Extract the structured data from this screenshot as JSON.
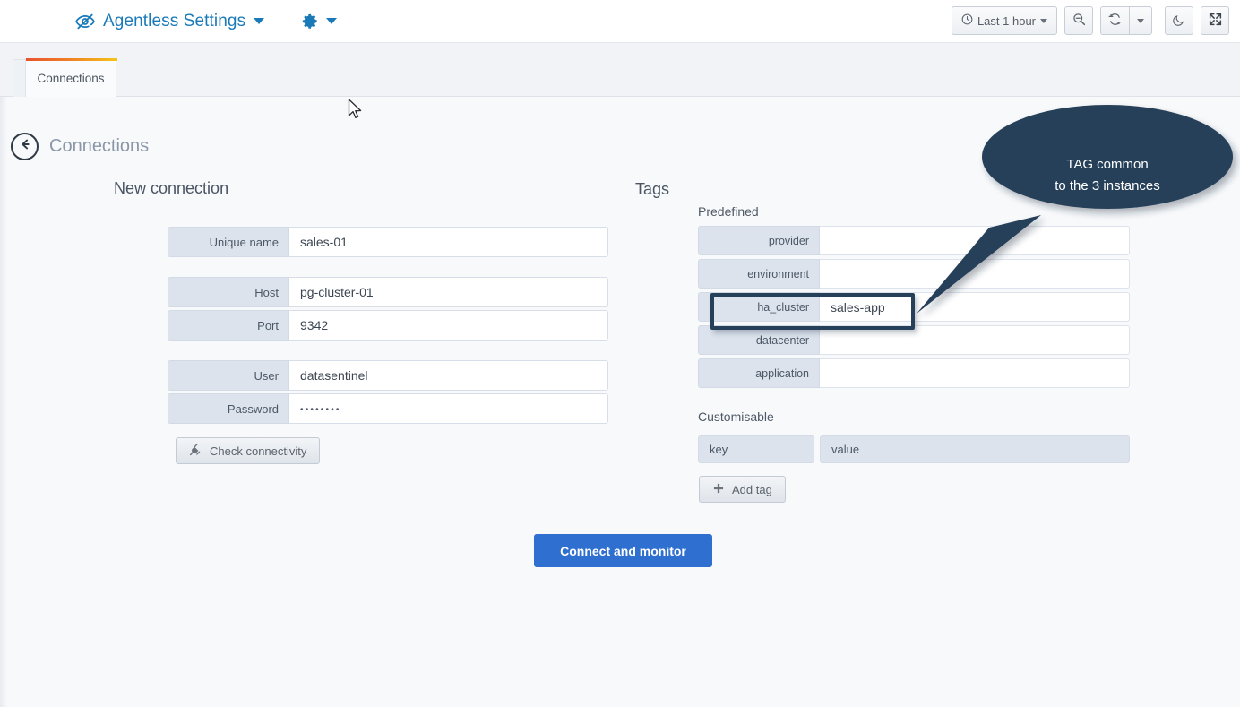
{
  "topbar": {
    "logo_icon": "eye-slash-icon",
    "brand_label": "Agentless Settings",
    "brand_caret_icon": "chevron-down-icon",
    "gear_icon": "gear-icon",
    "gear_caret_icon": "chevron-down-icon",
    "accent_color": "#1a7ab8",
    "tools": {
      "time_range_icon": "clock-icon",
      "time_range_label": "Last 1 hour",
      "time_range_caret_icon": "chevron-down-icon",
      "zoom_out_icon": "zoom-out-icon",
      "refresh_icon": "refresh-icon",
      "refresh_caret_icon": "chevron-down-icon",
      "dark_mode_icon": "moon-icon",
      "fullscreen_icon": "expand-icon"
    }
  },
  "tabs": [
    {
      "label": "Connections",
      "active": true
    }
  ],
  "breadcrumb": {
    "back_icon": "arrow-left-circle-icon",
    "title": "Connections"
  },
  "connection_form": {
    "title": "New connection",
    "fields": [
      {
        "label": "Unique name",
        "value": "sales-01",
        "type": "text"
      },
      {
        "label": "Host",
        "value": "pg-cluster-01",
        "type": "text"
      },
      {
        "label": "Port",
        "value": "9342",
        "type": "text"
      },
      {
        "label": "User",
        "value": "datasentinel",
        "type": "text"
      },
      {
        "label": "Password",
        "value": "••••••••",
        "type": "password"
      }
    ],
    "check_button": {
      "label": "Check connectivity",
      "icon": "plug-icon"
    }
  },
  "tags": {
    "title": "Tags",
    "predefined_title": "Predefined",
    "predefined": [
      {
        "key": "provider",
        "value": ""
      },
      {
        "key": "environment",
        "value": ""
      },
      {
        "key": "ha_cluster",
        "value": "sales-app"
      },
      {
        "key": "datacenter",
        "value": ""
      },
      {
        "key": "application",
        "value": ""
      }
    ],
    "customisable_title": "Customisable",
    "customisable_headers": {
      "key": "key",
      "value": "value"
    },
    "add_tag_button": {
      "label": "Add tag",
      "icon": "plus-icon"
    }
  },
  "submit": {
    "label": "Connect and monitor",
    "color": "#2f6fd0"
  },
  "annotation": {
    "line1": "TAG common",
    "line2": "to the 3 instances",
    "color": "#27405a",
    "target": "ha_cluster"
  }
}
